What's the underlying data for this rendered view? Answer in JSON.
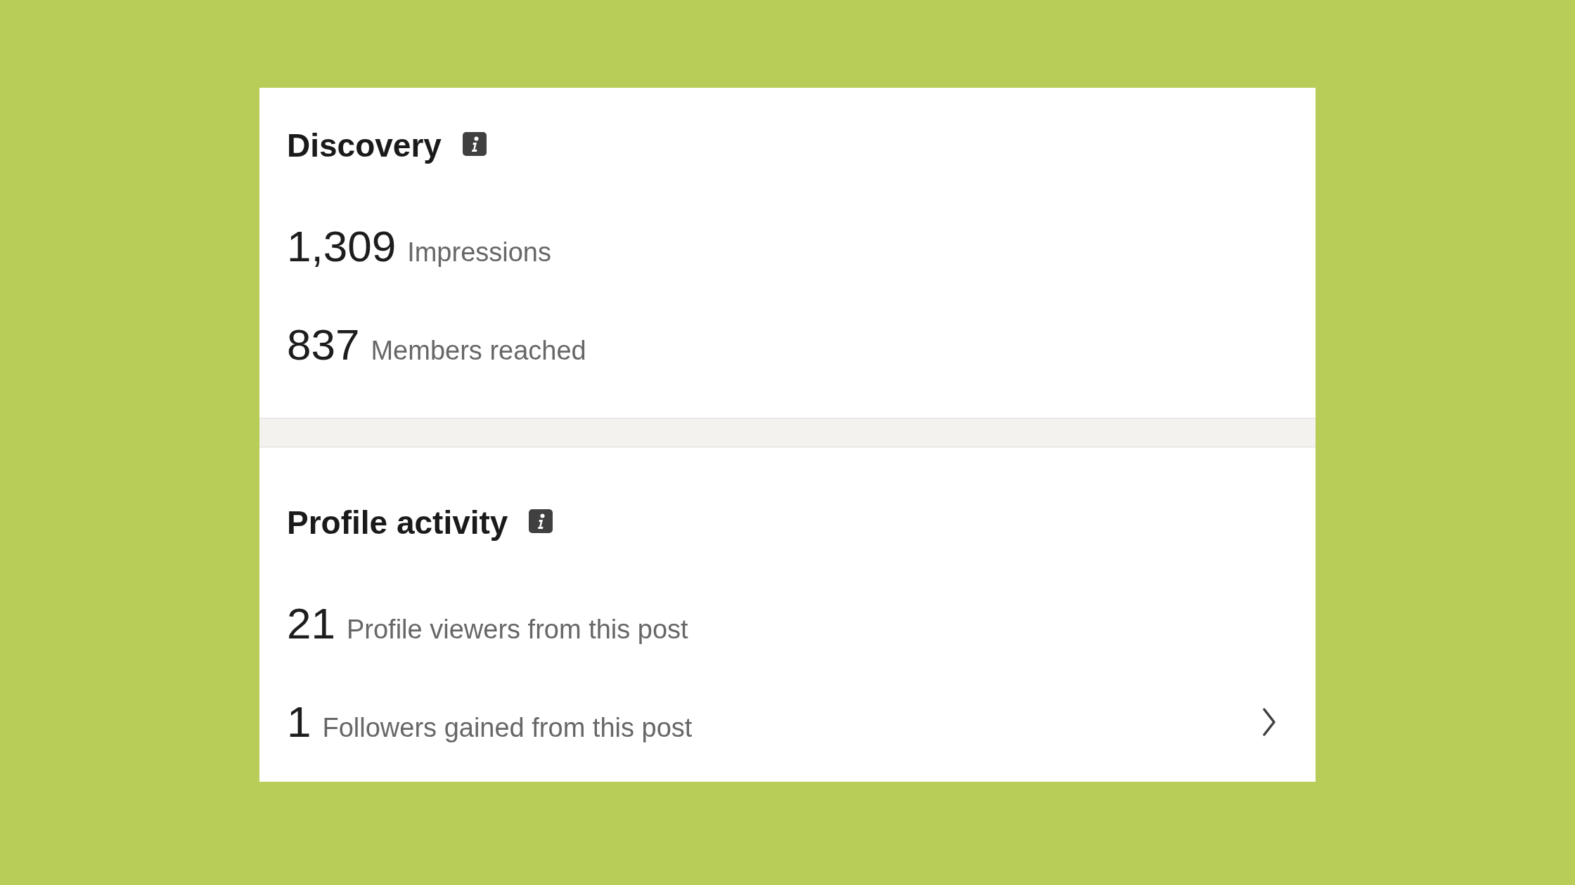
{
  "sections": [
    {
      "title": "Discovery",
      "stats": [
        {
          "kind": "stat",
          "value": "1,309",
          "label": "Impressions"
        },
        {
          "kind": "stat",
          "value": "837",
          "label": "Members reached"
        }
      ]
    },
    {
      "title": "Profile activity",
      "stats": [
        {
          "kind": "stat",
          "value": "21",
          "label": "Profile viewers from this post"
        },
        {
          "kind": "link",
          "value": "1",
          "label": "Followers gained from this post"
        }
      ]
    }
  ]
}
